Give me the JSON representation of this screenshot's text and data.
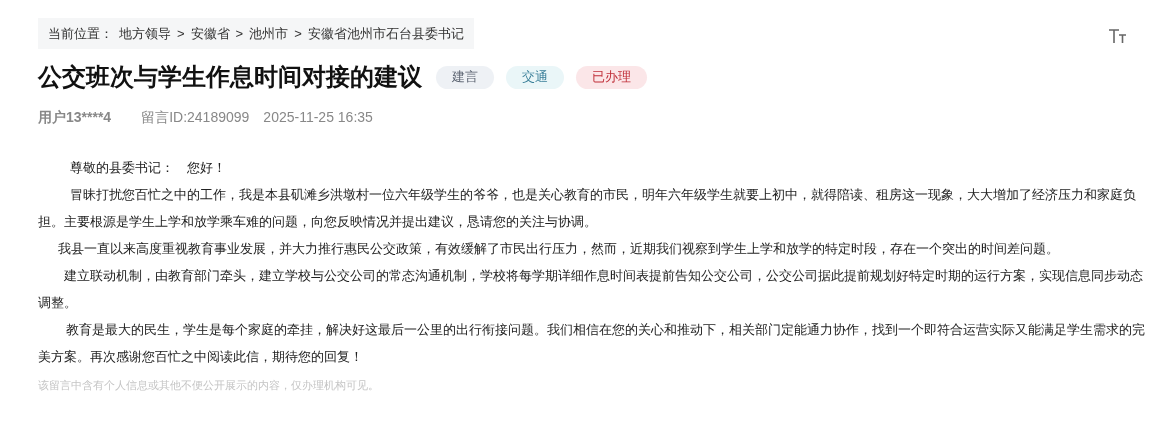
{
  "breadcrumb": {
    "label": "当前位置：",
    "items": [
      "地方领导",
      "安徽省",
      "池州市",
      "安徽省池州市石台县委书记"
    ],
    "separator": ">"
  },
  "title": "公交班次与学生作息时间对接的建议",
  "tags": [
    {
      "text": "建言",
      "kind": "type"
    },
    {
      "text": "交通",
      "kind": "topic"
    },
    {
      "text": "已办理",
      "kind": "status"
    }
  ],
  "meta": {
    "user": "用户13****4",
    "message_id": "留言ID:24189099",
    "time": "2025-11-25 16:35"
  },
  "greeting": "尊敬的县委书记：　您好！",
  "paragraphs": [
    "冒昧打扰您百忙之中的工作，我是本县矶滩乡洪墩村一位六年级学生的爷爷，也是关心教育的市民，明年六年级学生就要上初中，就得陪读、租房这一现象，大大增加了经济压力和家庭负担。主要根源是学生上学和放学乘车难的问题，向您反映情况并提出建议，恳请您的关注与协调。",
    "我县一直以来高度重视教育事业发展，并大力推行惠民公交政策，有效缓解了市民出行压力，然而，近期我们视察到学生上学和放学的特定时段，存在一个突出的时间差问题。",
    "建立联动机制，由教育部门牵头，建立学校与公交公司的常态沟通机制，学校将每学期详细作息时间表提前告知公交公司，公交公司据此提前规划好特定时期的运行方案，实现信息同步动态调整。",
    "教育是最大的民生，学生是每个家庭的牵挂，解决好这最后一公里的出行衔接问题。我们相信在您的关心和推动下，相关部门定能通力协作，找到一个即符合运营实际又能满足学生需求的完美方案。再次感谢您百忙之中阅读此信，期待您的回复！"
  ],
  "privacy_note": "该留言中含有个人信息或其他不便公开展示的内容，仅办理机构可见。"
}
